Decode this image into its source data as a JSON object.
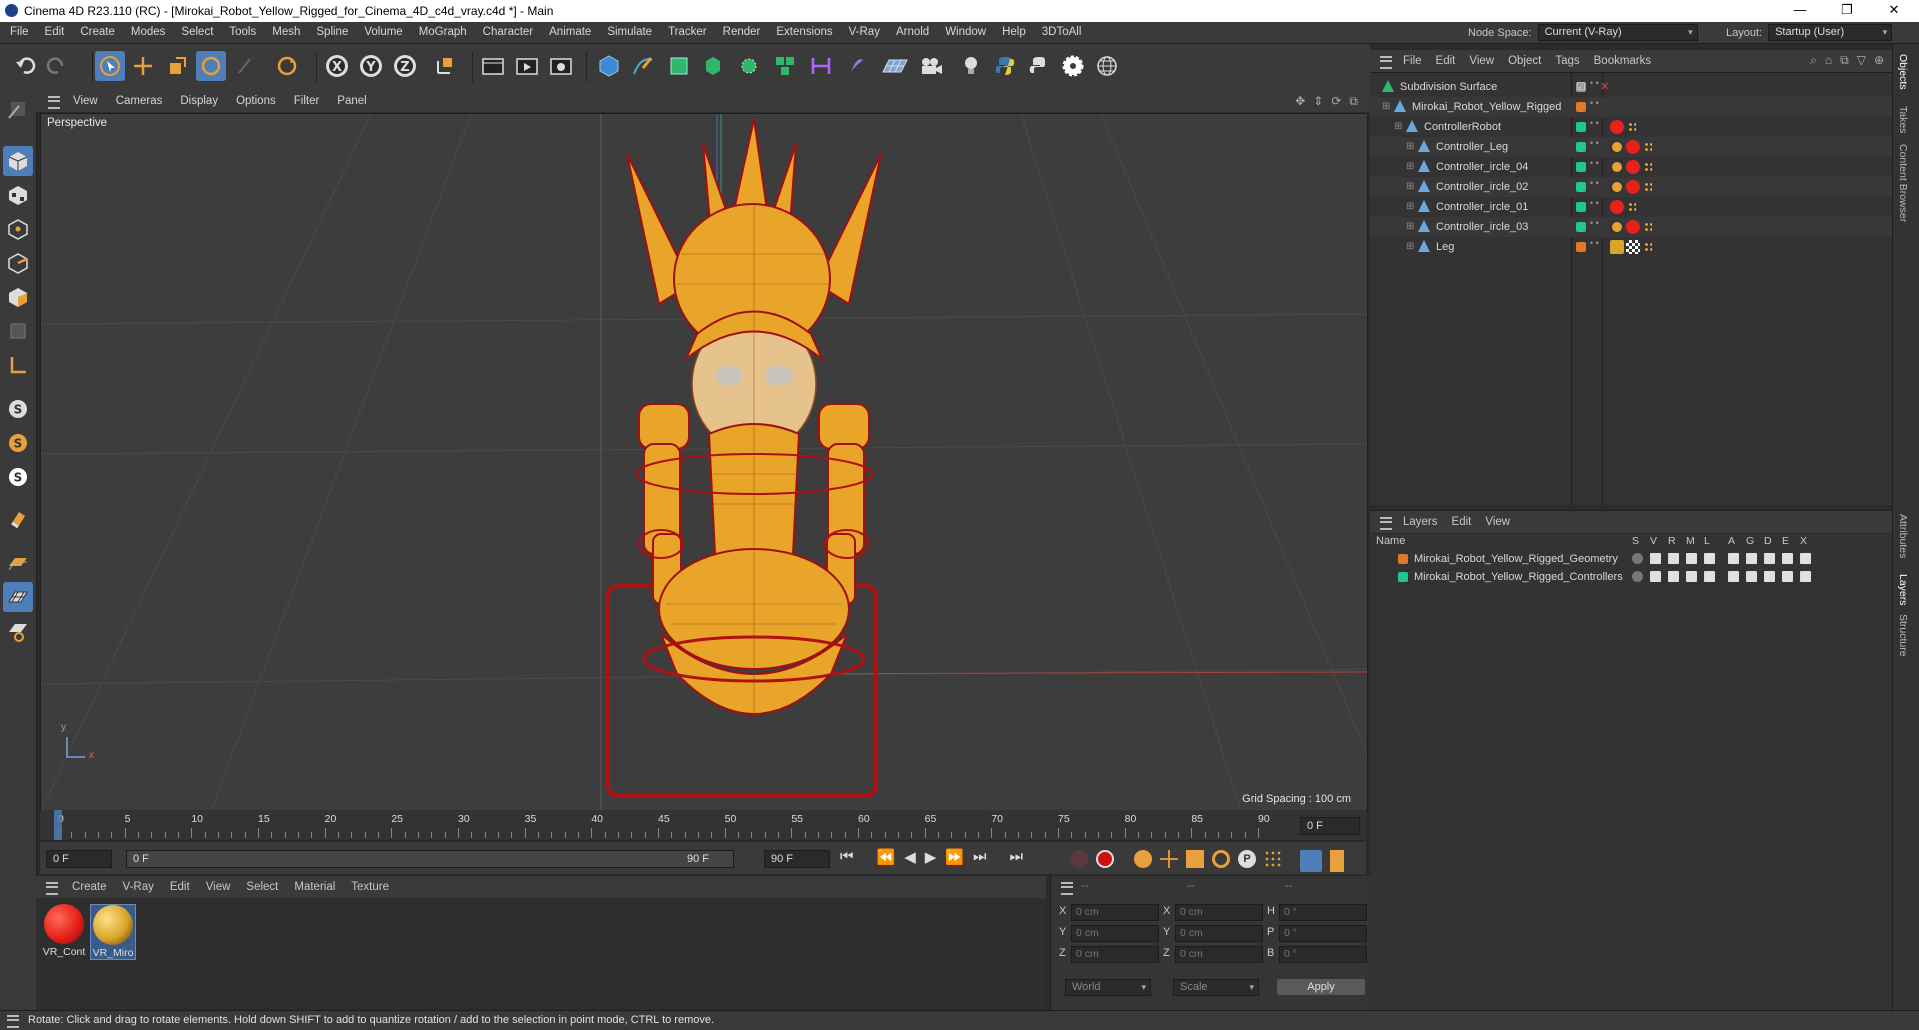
{
  "window": {
    "title": "Cinema 4D R23.110 (RC) - [Mirokai_Robot_Yellow_Rigged_for_Cinema_4D_c4d_vray.c4d *] - Main",
    "controls": [
      "—",
      "❐",
      "✕"
    ]
  },
  "menubar": {
    "items": [
      "File",
      "Edit",
      "Create",
      "Modes",
      "Select",
      "Tools",
      "Mesh",
      "Spline",
      "Volume",
      "MoGraph",
      "Character",
      "Animate",
      "Simulate",
      "Tracker",
      "Render",
      "Extensions",
      "V-Ray",
      "Arnold",
      "Window",
      "Help",
      "3DToAll"
    ],
    "node_space_label": "Node Space:",
    "node_space_value": "Current (V-Ray)",
    "layout_label": "Layout:",
    "layout_value": "Startup (User)"
  },
  "viewport": {
    "menu": [
      "View",
      "Cameras",
      "Display",
      "Options",
      "Filter",
      "Panel"
    ],
    "camera_label": "Perspective",
    "grid_spacing": "Grid Spacing : 100 cm",
    "axis_y": "y",
    "axis_x": "x"
  },
  "timeline": {
    "ticks": [
      "0",
      "5",
      "10",
      "15",
      "20",
      "25",
      "30",
      "35",
      "40",
      "45",
      "50",
      "55",
      "60",
      "65",
      "70",
      "75",
      "80",
      "85",
      "90"
    ],
    "end_field": "0 F",
    "start_frame": "0 F",
    "current_frame": "0 F",
    "range_end": "90 F",
    "max_frame": "90 F"
  },
  "materials": {
    "menu": [
      "Create",
      "V-Ray",
      "Edit",
      "View",
      "Select",
      "Material",
      "Texture"
    ],
    "items": [
      {
        "label": "VR_Cont",
        "color": "#e8201a"
      },
      {
        "label": "VR_Miro",
        "color": "#d8a52a"
      }
    ]
  },
  "coordinates": {
    "headers": [
      "--",
      "--",
      "--"
    ],
    "rows": [
      {
        "a": "X",
        "av": "0 cm",
        "b": "X",
        "bv": "0 cm",
        "c": "H",
        "cv": "0 °"
      },
      {
        "a": "Y",
        "av": "0 cm",
        "b": "Y",
        "bv": "0 cm",
        "c": "P",
        "cv": "0 °"
      },
      {
        "a": "Z",
        "av": "0 cm",
        "b": "Z",
        "bv": "0 cm",
        "c": "B",
        "cv": "0 °"
      }
    ],
    "mode": "World",
    "scale": "Scale",
    "apply": "Apply"
  },
  "objects": {
    "menu": [
      "File",
      "Edit",
      "View",
      "Object",
      "Tags",
      "Bookmarks"
    ],
    "tree": [
      {
        "name": "Subdivision Surface",
        "depth": 0,
        "color": "#9a9a9a"
      },
      {
        "name": "Mirokai_Robot_Yellow_Rigged",
        "depth": 1,
        "color": "#e07a2a"
      },
      {
        "name": "ControllerRobot",
        "depth": 2,
        "color": "#20c890"
      },
      {
        "name": "Controller_Leg",
        "depth": 3,
        "color": "#20c890"
      },
      {
        "name": "Controller_ircle_04",
        "depth": 3,
        "color": "#20c890"
      },
      {
        "name": "Controller_ircle_02",
        "depth": 3,
        "color": "#20c890"
      },
      {
        "name": "Controller_ircle_01",
        "depth": 3,
        "color": "#20c890"
      },
      {
        "name": "Controller_ircle_03",
        "depth": 3,
        "color": "#20c890"
      },
      {
        "name": "Leg",
        "depth": 3,
        "color": "#e07a2a"
      }
    ]
  },
  "layers": {
    "menu": [
      "Layers",
      "Edit",
      "View"
    ],
    "name_header": "Name",
    "col_headers": [
      "S",
      "V",
      "R",
      "M",
      "L",
      "A",
      "G",
      "D",
      "E",
      "X"
    ],
    "items": [
      {
        "name": "Mirokai_Robot_Yellow_Rigged_Geometry",
        "color": "#e07a2a"
      },
      {
        "name": "Mirokai_Robot_Yellow_Rigged_Controllers",
        "color": "#20c890"
      }
    ]
  },
  "side_tabs": [
    "Objects",
    "Takes",
    "Content Browser",
    "Attributes",
    "Layers",
    "Structure"
  ],
  "status": "Rotate: Click and drag to rotate elements. Hold down SHIFT to add to quantize rotation / add to the selection in point mode, CTRL to remove."
}
